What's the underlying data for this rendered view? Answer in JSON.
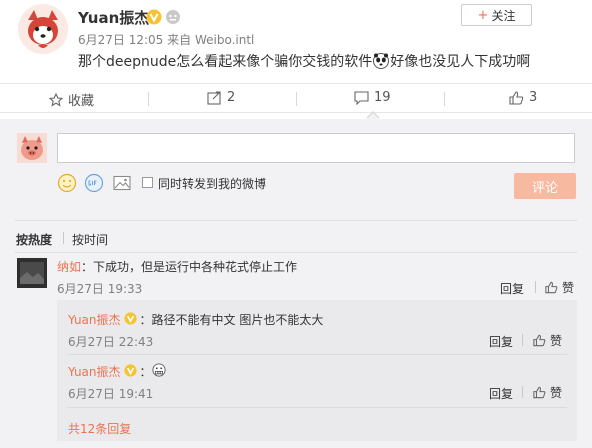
{
  "post": {
    "author": "Yuan振杰",
    "timestamp": "6月27日 12:05",
    "source": "来自 Weibo.intl",
    "text_before_emoji": "那个deepnude怎么看起来像个骗你交钱的软件",
    "text_after_emoji": "好像也没见人下成功啊",
    "follow_plus": "+",
    "follow_label": "关注",
    "verified_badge": "V",
    "avatar_icon": "cartoon-fox-avatar",
    "emoji_icon": "panda-face-emoji"
  },
  "actions": {
    "favorite_label": "收藏",
    "repost_count": "2",
    "comment_count": "19",
    "like_count": "3"
  },
  "composer": {
    "placeholder": "",
    "repost_checkbox_label": "同时转发到我的微博",
    "submit_label": "评论",
    "checked": false
  },
  "sort": {
    "hot_label": "按热度",
    "time_label": "按时间"
  },
  "comment": {
    "username": "纳如",
    "text": "：下成功，但是运行中各种花式停止工作",
    "time": "6月27日 19:33",
    "reply_label": "回复",
    "like_label": "赞"
  },
  "sub_replies": [
    {
      "username": "Yuan振杰",
      "text": "：路径不能有中文 图片也不能太大",
      "time": "6月27日 22:43",
      "reply_label": "回复",
      "like_label": "赞"
    },
    {
      "username": "Yuan振杰",
      "text": "：",
      "emoji": "grimace-emoji",
      "time": "6月27日 19:41",
      "reply_label": "回复",
      "like_label": "赞"
    }
  ],
  "more_replies": "共12条回复",
  "colors": {
    "accent": "#eb7350",
    "badge": "#f6c333",
    "panel_bg": "#f2f2f5",
    "submit_bg": "#f7b9a0"
  }
}
